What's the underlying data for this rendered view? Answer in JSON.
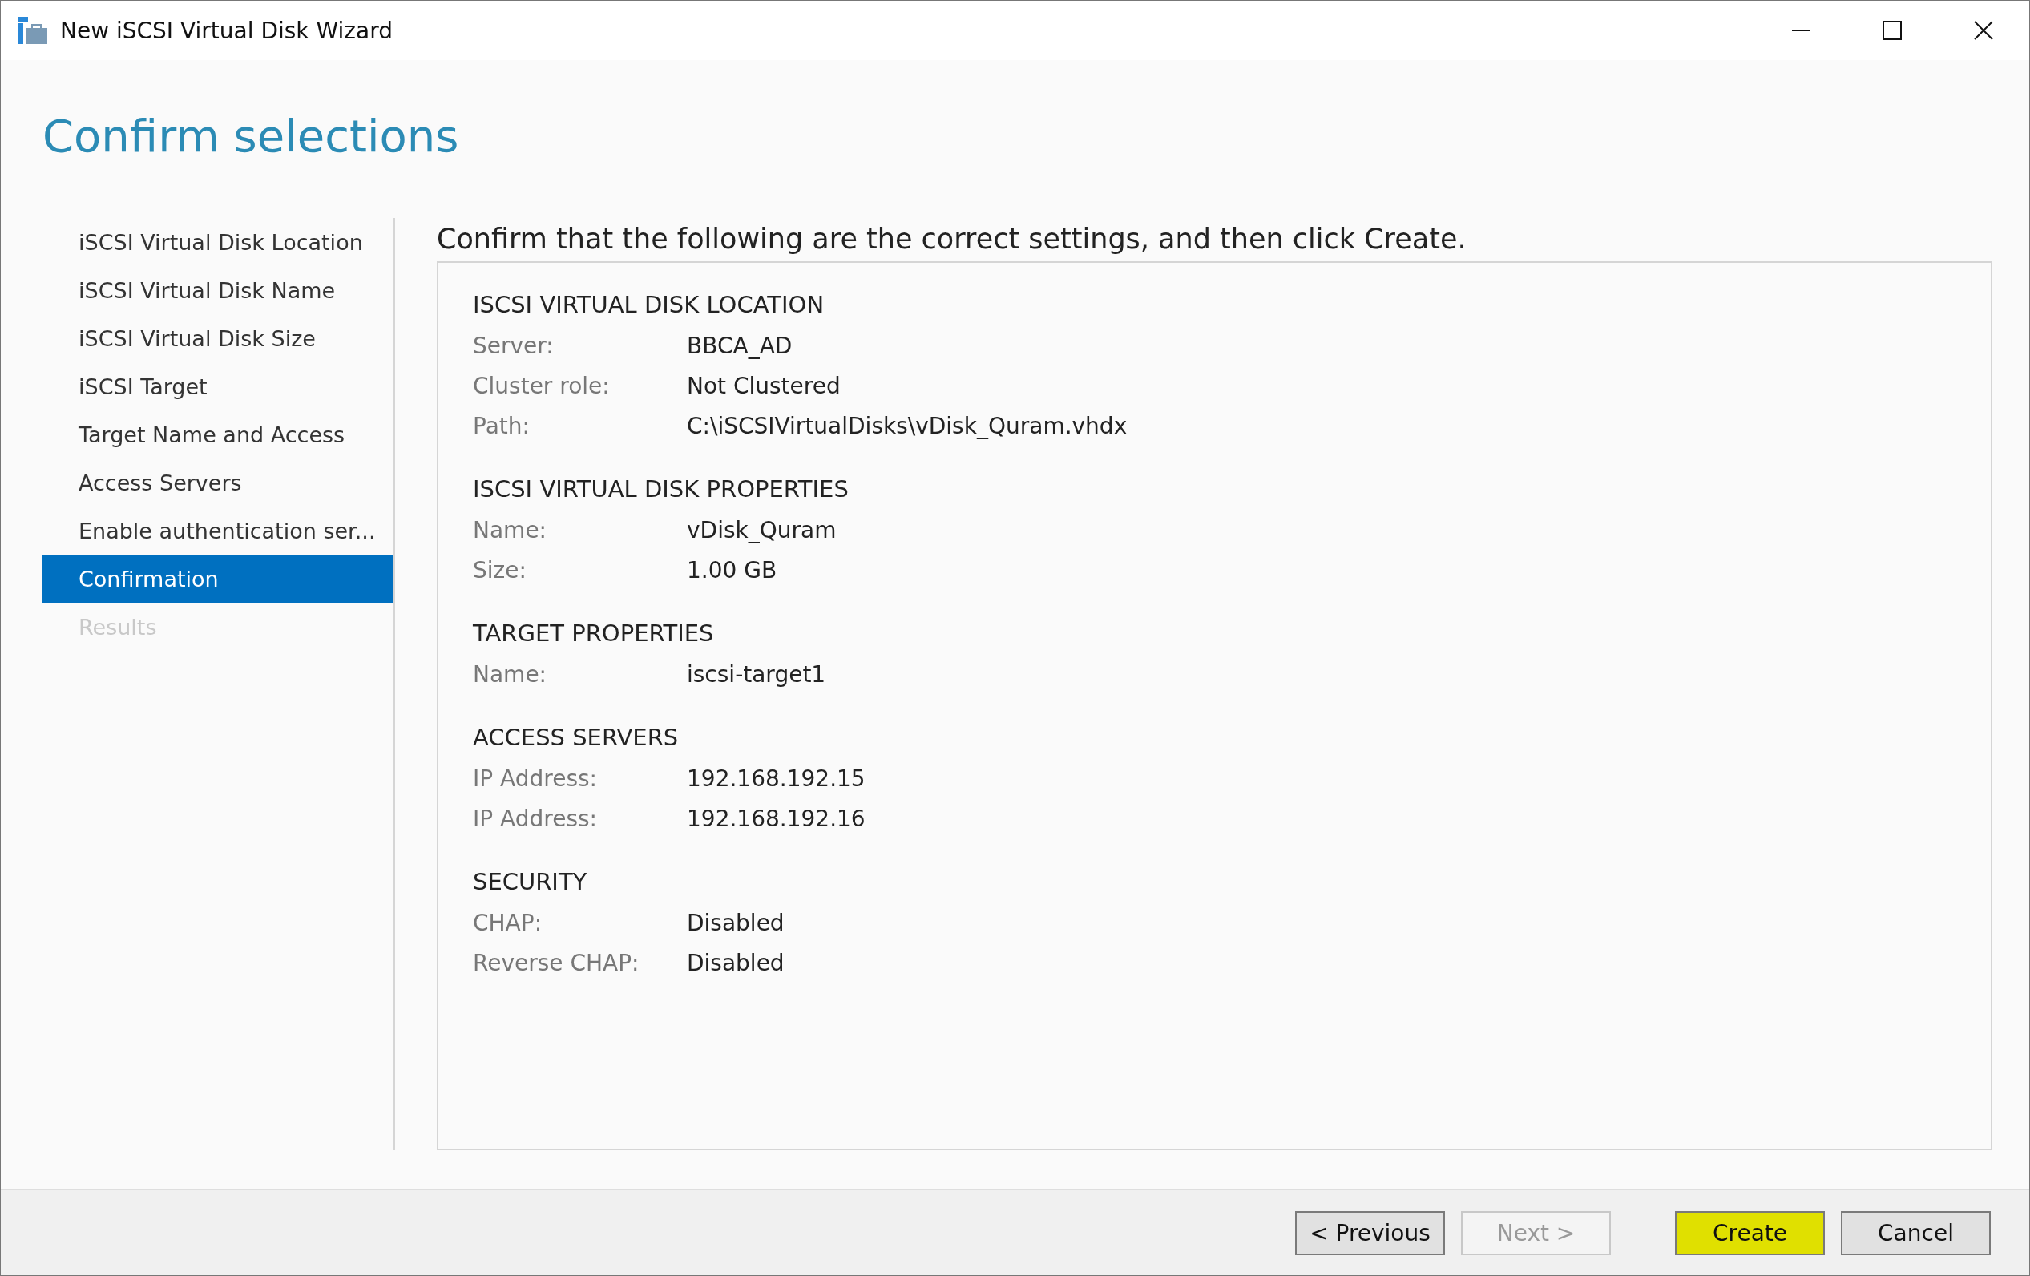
{
  "window": {
    "title": "New iSCSI Virtual Disk Wizard"
  },
  "page_title": "Confirm selections",
  "steps": [
    {
      "label": "iSCSI Virtual Disk Location",
      "selected": false,
      "disabled": false
    },
    {
      "label": "iSCSI Virtual Disk Name",
      "selected": false,
      "disabled": false
    },
    {
      "label": "iSCSI Virtual Disk Size",
      "selected": false,
      "disabled": false
    },
    {
      "label": "iSCSI Target",
      "selected": false,
      "disabled": false
    },
    {
      "label": "Target Name and Access",
      "selected": false,
      "disabled": false
    },
    {
      "label": "Access Servers",
      "selected": false,
      "disabled": false
    },
    {
      "label": "Enable authentication ser...",
      "selected": false,
      "disabled": false
    },
    {
      "label": "Confirmation",
      "selected": true,
      "disabled": false
    },
    {
      "label": "Results",
      "selected": false,
      "disabled": true
    }
  ],
  "instruction": "Confirm that the following are the correct settings, and then click Create.",
  "sections": [
    {
      "heading": "ISCSI VIRTUAL DISK LOCATION",
      "rows": [
        {
          "label": "Server:",
          "value": "BBCA_AD"
        },
        {
          "label": "Cluster role:",
          "value": "Not Clustered"
        },
        {
          "label": "Path:",
          "value": "C:\\iSCSIVirtualDisks\\vDisk_Quram.vhdx"
        }
      ]
    },
    {
      "heading": "ISCSI VIRTUAL DISK PROPERTIES",
      "rows": [
        {
          "label": "Name:",
          "value": "vDisk_Quram"
        },
        {
          "label": "Size:",
          "value": "1.00 GB"
        }
      ]
    },
    {
      "heading": "TARGET PROPERTIES",
      "rows": [
        {
          "label": "Name:",
          "value": "iscsi-target1"
        }
      ]
    },
    {
      "heading": "ACCESS SERVERS",
      "rows": [
        {
          "label": "IP Address:",
          "value": "192.168.192.15"
        },
        {
          "label": "IP Address:",
          "value": "192.168.192.16"
        }
      ]
    },
    {
      "heading": "SECURITY",
      "rows": [
        {
          "label": "CHAP:",
          "value": "Disabled"
        },
        {
          "label": "Reverse CHAP:",
          "value": "Disabled"
        }
      ]
    }
  ],
  "buttons": [
    {
      "label": "< Previous",
      "disabled": false,
      "highlighted": false
    },
    {
      "label": "Next >",
      "disabled": true,
      "highlighted": false
    },
    {
      "label": "Create",
      "disabled": false,
      "highlighted": true
    },
    {
      "label": "Cancel",
      "disabled": false,
      "highlighted": false
    }
  ]
}
